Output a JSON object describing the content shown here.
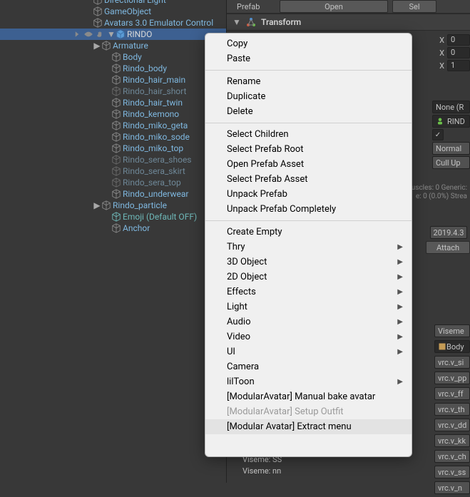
{
  "hierarchy": {
    "top": [
      {
        "label": "Directional Light",
        "class": "blue",
        "indent": 130
      },
      {
        "label": "GameObject",
        "class": "blue",
        "indent": 130
      },
      {
        "label": "Avatars 3.0 Emulator Control",
        "class": "blue",
        "indent": 130
      }
    ],
    "selected": {
      "label": "RINDO",
      "class": "white",
      "indent": 116
    },
    "children": [
      {
        "label": "Armature",
        "class": "blue",
        "indent": 130,
        "fold": true
      },
      {
        "label": "Body",
        "class": "blue",
        "indent": 144
      },
      {
        "label": "Rindo_body",
        "class": "blue",
        "indent": 144
      },
      {
        "label": "Rindo_hair_main",
        "class": "blue",
        "indent": 144
      },
      {
        "label": "Rindo_hair_short",
        "class": "grey",
        "indent": 144
      },
      {
        "label": "Rindo_hair_twin",
        "class": "blue",
        "indent": 144
      },
      {
        "label": "Rindo_kemono",
        "class": "blue",
        "indent": 144
      },
      {
        "label": "Rindo_miko_geta",
        "class": "blue",
        "indent": 144
      },
      {
        "label": "Rindo_miko_sode",
        "class": "blue",
        "indent": 144
      },
      {
        "label": "Rindo_miko_top",
        "class": "blue",
        "indent": 144
      },
      {
        "label": "Rindo_sera_shoes",
        "class": "grey",
        "indent": 144
      },
      {
        "label": "Rindo_sera_skirt",
        "class": "grey",
        "indent": 144
      },
      {
        "label": "Rindo_sera_top",
        "class": "grey",
        "indent": 144
      },
      {
        "label": "Rindo_underwear",
        "class": "blue",
        "indent": 144
      },
      {
        "label": "Rindo_particle",
        "class": "blue",
        "indent": 130,
        "fold": true
      },
      {
        "label": "Emoji (Default OFF)",
        "class": "teal",
        "indent": 144
      },
      {
        "label": "Anchor",
        "class": "blue",
        "indent": 144
      }
    ]
  },
  "inspector": {
    "prefab_label": "Prefab",
    "open_btn": "Open",
    "sel_btn": "Sel",
    "transform_label": "Transform",
    "pos": {
      "axis": "X",
      "val": "0"
    },
    "rot": {
      "axis": "X",
      "val": "0"
    },
    "scl": {
      "axis": "X",
      "val": "1"
    },
    "none_label": "None (R",
    "rindo_label": "RIND",
    "normal_label": "Normal",
    "cull_label": "Cull Up",
    "stats1": "uscles: 0 Generic:",
    "stats2": "e: 0 (0.0%) Strea",
    "year": "2019.4.3",
    "attach": "Attach",
    "viseme_label": "Viseme",
    "body_label": "Body",
    "vrc": [
      "vrc.v_si",
      "vrc.v_pp",
      "vrc.v_ff",
      "vrc.v_th",
      "vrc.v_dd",
      "vrc.v_kk",
      "vrc.v_ch",
      "vrc.v_ss",
      "vrc.v_n"
    ],
    "viseme_ss": "Viseme: SS",
    "viseme_nn": "Viseme: nn"
  },
  "context_menu": {
    "groups": [
      [
        {
          "label": "Copy"
        },
        {
          "label": "Paste"
        }
      ],
      [
        {
          "label": "Rename"
        },
        {
          "label": "Duplicate"
        },
        {
          "label": "Delete"
        }
      ],
      [
        {
          "label": "Select Children"
        },
        {
          "label": "Select Prefab Root"
        },
        {
          "label": "Open Prefab Asset"
        },
        {
          "label": "Select Prefab Asset"
        },
        {
          "label": "Unpack Prefab"
        },
        {
          "label": "Unpack Prefab Completely"
        }
      ],
      [
        {
          "label": "Create Empty"
        },
        {
          "label": "Thry",
          "sub": true
        },
        {
          "label": "3D Object",
          "sub": true
        },
        {
          "label": "2D Object",
          "sub": true
        },
        {
          "label": "Effects",
          "sub": true
        },
        {
          "label": "Light",
          "sub": true
        },
        {
          "label": "Audio",
          "sub": true
        },
        {
          "label": "Video",
          "sub": true
        },
        {
          "label": "UI",
          "sub": true
        },
        {
          "label": "Camera"
        },
        {
          "label": "lilToon",
          "sub": true
        },
        {
          "label": "[ModularAvatar] Manual bake avatar"
        },
        {
          "label": "[ModularAvatar] Setup Outfit",
          "disabled": true
        },
        {
          "label": "[Modular Avatar] Extract menu",
          "highlighted": true
        }
      ]
    ]
  }
}
